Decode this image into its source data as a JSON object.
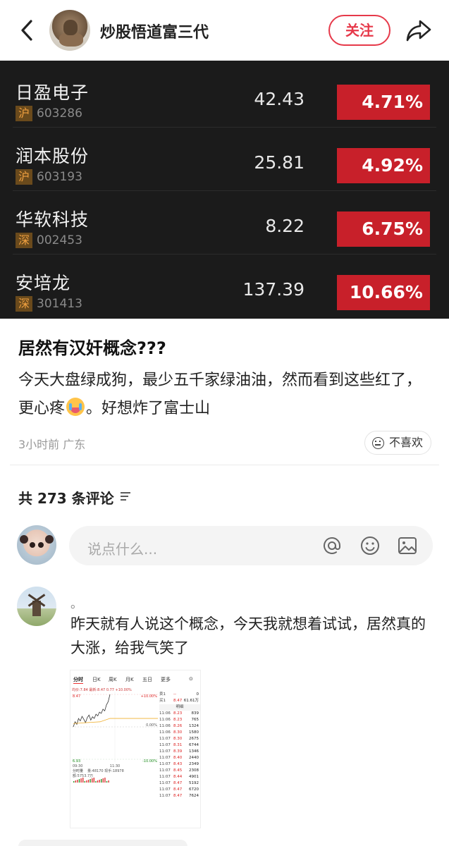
{
  "header": {
    "username": "炒股悟道富三代",
    "follow_label": "关注"
  },
  "stocks": [
    {
      "name": "日盈电子",
      "exchange": "沪",
      "code": "603286",
      "price": "42.43",
      "change": "4.71%"
    },
    {
      "name": "润本股份",
      "exchange": "沪",
      "code": "603193",
      "price": "25.81",
      "change": "4.92%"
    },
    {
      "name": "华软科技",
      "exchange": "深",
      "code": "002453",
      "price": "8.22",
      "change": "6.75%"
    },
    {
      "name": "安培龙",
      "exchange": "深",
      "code": "301413",
      "price": "137.39",
      "change": "10.66%"
    }
  ],
  "colors": {
    "accent": "#e6394a",
    "board_bg": "#1b1b1b",
    "rise_red": "#c8202a"
  },
  "post": {
    "title": "居然有汉奸概念???",
    "body_part1": "今天大盘绿成狗，最少五千家绿油油，然而看到这些红了，更心疼",
    "body_part2": "。好想炸了富士山",
    "meta": "3小时前 广东",
    "dislike_label": "不喜欢"
  },
  "comments": {
    "count_label": "共 273 条评论",
    "input_placeholder": "说点什么...",
    "items": [
      {
        "author": "。",
        "text": "昨天就有人说这个概念，今天我就想着试试，居然真的大涨，给我气笑了"
      }
    ]
  },
  "screenshot": {
    "tabs": [
      "分时",
      "日K",
      "周K",
      "月K",
      "五日",
      "更多"
    ],
    "info": "均价:7.84 最新:8.47 0.77 +10.00%",
    "top_price": "8.47",
    "top_pct": "+10.00%",
    "mid_pct": "0.00%",
    "bottom_price": "6.93",
    "bottom_pct": "-10.00%",
    "time_start": "09:30",
    "time_mid": "11:30",
    "sell1_label": "卖1",
    "sell1_price": "--",
    "sell1_vol": "0",
    "buy1_label": "买1",
    "buy1_price": "8.47",
    "buy1_vol": "61.61万",
    "detail_label": "明细",
    "vol_label": "分时量",
    "vol_info": "量:48170 现手:18978",
    "amount_label": "额:5753.7万",
    "trades": [
      {
        "t": "11:06",
        "p": "8.23",
        "v": "839"
      },
      {
        "t": "11:06",
        "p": "8.23",
        "v": "765"
      },
      {
        "t": "11:06",
        "p": "8.26",
        "v": "1324"
      },
      {
        "t": "11:06",
        "p": "8.30",
        "v": "1580"
      },
      {
        "t": "11:07",
        "p": "8.30",
        "v": "2675"
      },
      {
        "t": "11:07",
        "p": "8.31",
        "v": "6744"
      },
      {
        "t": "11:07",
        "p": "8.39",
        "v": "1346"
      },
      {
        "t": "11:07",
        "p": "8.40",
        "v": "2440"
      },
      {
        "t": "11:07",
        "p": "8.43",
        "v": "2349"
      },
      {
        "t": "11:07",
        "p": "8.45",
        "v": "2308"
      },
      {
        "t": "11:07",
        "p": "8.44",
        "v": "4901"
      },
      {
        "t": "11:07",
        "p": "8.47",
        "v": "5192"
      },
      {
        "t": "11:07",
        "p": "8.47",
        "v": "6720"
      },
      {
        "t": "11:07",
        "p": "8.47",
        "v": "7624"
      }
    ],
    "price_series": [
      7.7,
      7.82,
      7.76,
      7.9,
      7.84,
      7.95,
      7.88,
      7.8,
      7.92,
      7.98,
      7.86,
      7.94,
      7.9,
      8.0,
      7.96,
      8.05,
      8.02,
      8.12,
      8.08,
      8.22,
      8.3,
      8.47
    ]
  }
}
